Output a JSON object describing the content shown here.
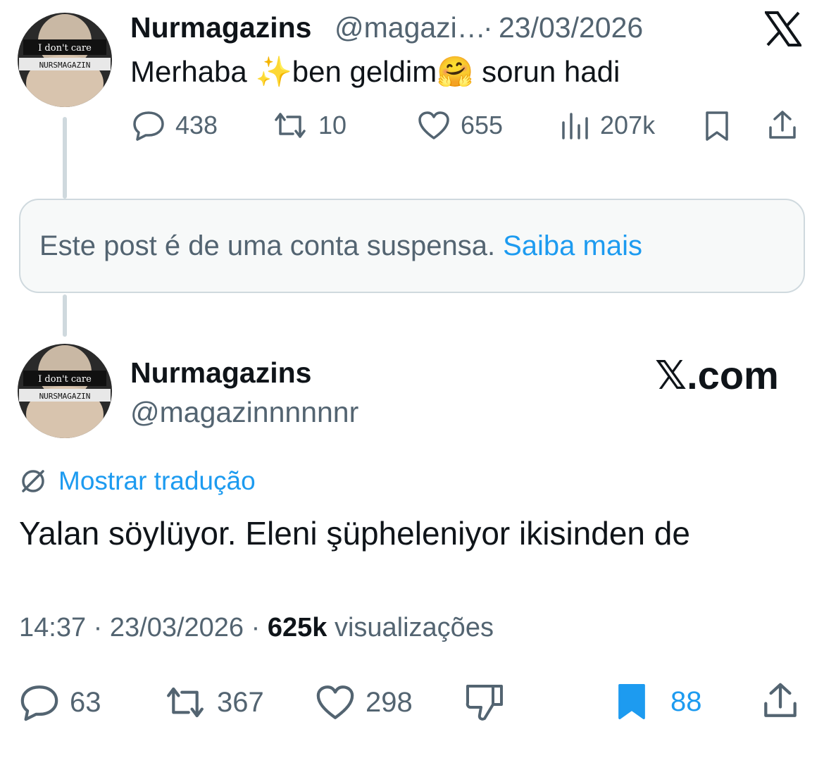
{
  "tweet1": {
    "author_name": "Nurmagazins",
    "handle": "@magazi…",
    "sep": "·",
    "date": "23/03/2026",
    "text_a": "Merhaba ",
    "emoji_a": "✨",
    "text_b": "ben geldim",
    "emoji_b": "🤗",
    "text_c": " sorun hadi",
    "replies": "438",
    "reposts": "10",
    "likes": "655",
    "views": "207k"
  },
  "avatar": {
    "caption1": "I don't care",
    "caption2": "NURSMAGAZIN"
  },
  "suspended_notice": {
    "text": "Este post é de uma conta suspensa.",
    "link": "Saiba mais"
  },
  "tweet2": {
    "author_name": "Nurmagazins",
    "handle": "@magazinnnnnnr",
    "brand": "𝕏.com",
    "translate_label": "Mostrar tradução",
    "text": "Yalan söylüyor. Eleni şüpheleniyor ikisinden de",
    "time": "14:37",
    "sep": "·",
    "date": "23/03/2026",
    "views_count": "625k",
    "views_label": "visualizações",
    "replies": "63",
    "reposts": "367",
    "likes": "298",
    "bookmarks": "88"
  },
  "colors": {
    "link": "#1d9bf0",
    "muted": "#536471",
    "text": "#0f1419",
    "border": "#cfd9de"
  },
  "icons": [
    "x-logo-icon",
    "reply-icon",
    "repost-icon",
    "like-icon",
    "views-icon",
    "bookmark-icon",
    "share-icon",
    "translate-icon",
    "dislike-icon"
  ]
}
